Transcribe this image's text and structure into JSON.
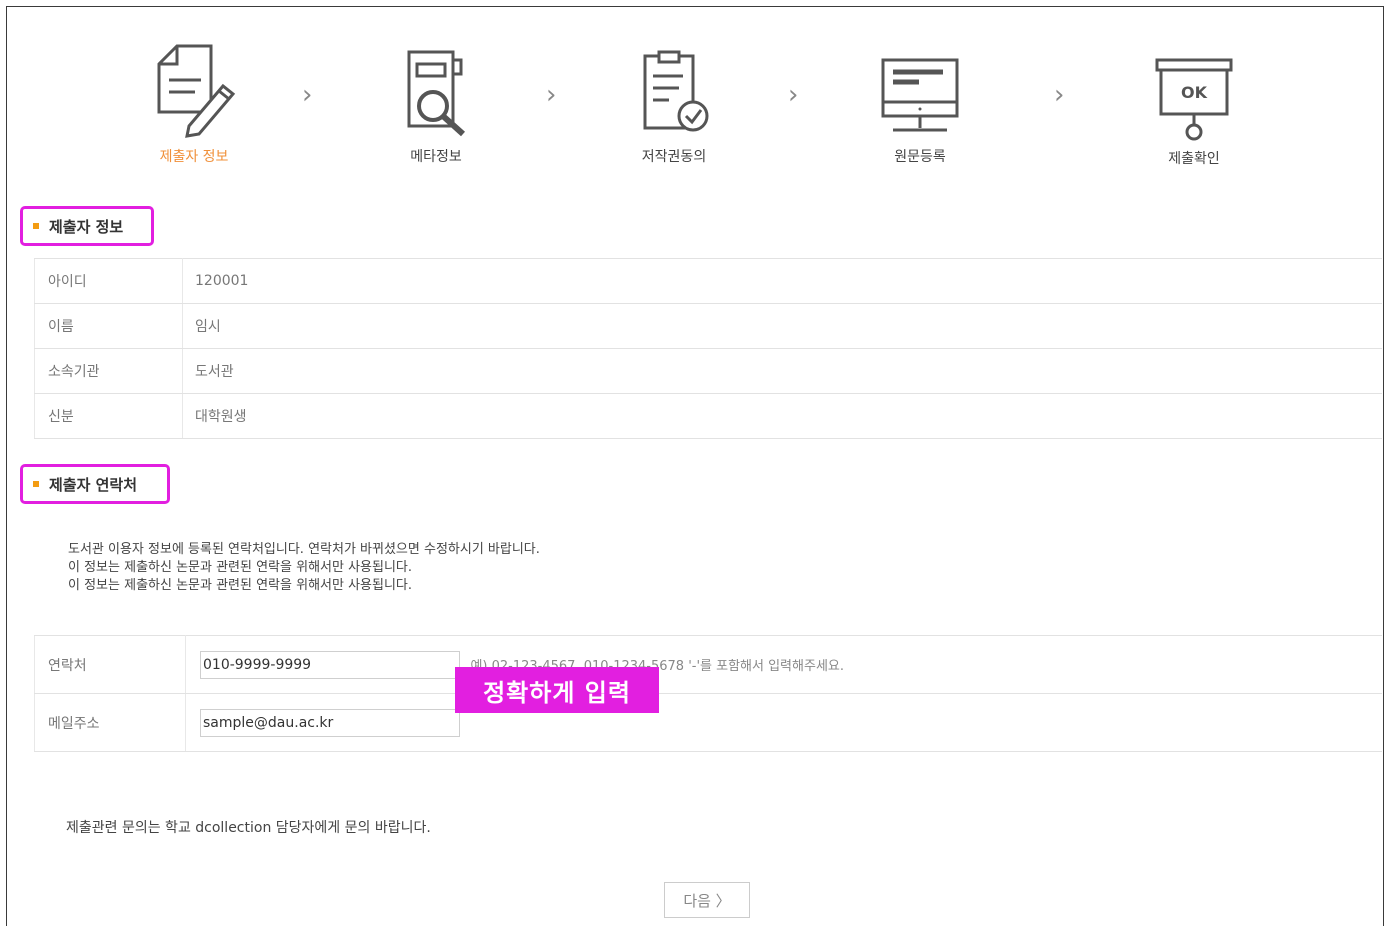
{
  "steps": [
    {
      "label": "제출자 정보",
      "icon": "document-edit-icon",
      "active": true
    },
    {
      "label": "메타정보",
      "icon": "document-search-icon",
      "active": false
    },
    {
      "label": "저작권동의",
      "icon": "document-check-icon",
      "active": false
    },
    {
      "label": "원문등록",
      "icon": "monitor-icon",
      "active": false
    },
    {
      "label": "제출확인",
      "icon": "ok-box-icon",
      "active": false
    }
  ],
  "step_arrow": "›",
  "submitter_info": {
    "title": "제출자 정보",
    "rows": [
      {
        "label": "아이디",
        "value": "120001"
      },
      {
        "label": "이름",
        "value": "임시"
      },
      {
        "label": "소속기관",
        "value": "도서관"
      },
      {
        "label": "신분",
        "value": "대학원생"
      }
    ]
  },
  "submitter_contact": {
    "title": "제출자 연락처",
    "notice": [
      "도서관 이용자 정보에 등록된 연락처입니다. 연락처가 바뀌셨으면 수정하시기 바랍니다.",
      "이 정보는 제출하신 논문과 관련된 연락을 위해서만 사용됩니다.",
      "이 정보는 제출하신 논문과 관련된 연락을 위해서만 사용됩니다."
    ],
    "phone_label": "연락처",
    "phone_value": "010-9999-9999",
    "phone_hint": "예) 02-123-4567, 010-1234-5678 '-'를 포함해서 입력해주세요.",
    "email_label": "메일주소",
    "email_value": "sample@dau.ac.kr"
  },
  "callout": "정확하게 입력",
  "footer_note": "제출관련 문의는 학교 dcollection 담당자에게 문의 바랍니다.",
  "next_button": "다음 〉",
  "colors": {
    "accent": "#f0903a",
    "highlight": "#e21fe0",
    "bullet": "#f39c12"
  }
}
